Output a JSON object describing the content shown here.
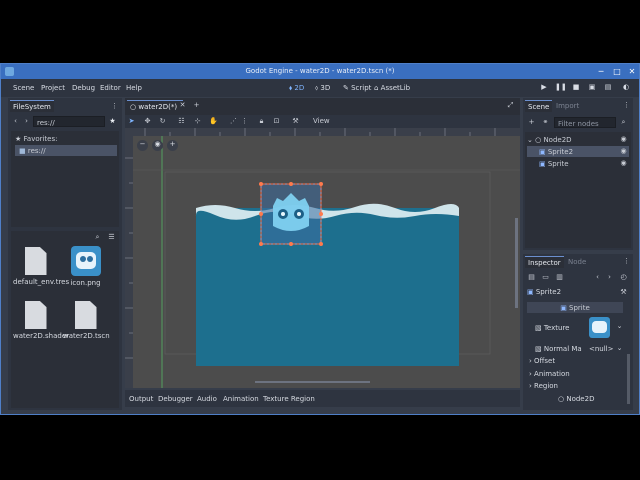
{
  "window": {
    "title": "Godot Engine - water2D - water2D.tscn (*)",
    "minimize": "─",
    "maximize": "□",
    "close": "✕"
  },
  "menubar": {
    "items": [
      "Scene",
      "Project",
      "Debug",
      "Editor",
      "Help"
    ],
    "modes": [
      "2D",
      "3D",
      "Script",
      "AssetLib"
    ],
    "active_mode": "2D"
  },
  "filesystem": {
    "tab": "FileSystem",
    "path": "res://",
    "favorites_label": "Favorites:",
    "root_item": "res://",
    "files": [
      {
        "name": "default_env.tres",
        "type": "doc"
      },
      {
        "name": "icon.png",
        "type": "image"
      },
      {
        "name": "water2D.shader",
        "type": "doc"
      },
      {
        "name": "water2D.tscn",
        "type": "doc"
      }
    ]
  },
  "editor": {
    "scene_tab": "water2D(*)",
    "add_tab": "+",
    "view_menu": "View"
  },
  "bottom_tabs": [
    "Output",
    "Debugger",
    "Audio",
    "Animation",
    "Texture Region"
  ],
  "scene_dock": {
    "tabs": [
      "Scene",
      "Import"
    ],
    "filter_placeholder": "Filter nodes",
    "nodes": [
      {
        "name": "Node2D",
        "level": 0,
        "selected": false
      },
      {
        "name": "Sprite2",
        "level": 1,
        "selected": true
      },
      {
        "name": "Sprite",
        "level": 1,
        "selected": false
      }
    ]
  },
  "inspector": {
    "tabs": [
      "Inspector",
      "Node"
    ],
    "object": "Sprite2",
    "class_header": "Sprite",
    "texture_label": "Texture",
    "normal_map_label": "Normal Ma",
    "normal_map_value": "<null>",
    "sections": [
      "Offset",
      "Animation",
      "Region"
    ],
    "footer": "Node2D"
  },
  "colors": {
    "accent": "#7fb5ff",
    "water": "#1d6f8e",
    "selection": "#ff6a3d"
  }
}
